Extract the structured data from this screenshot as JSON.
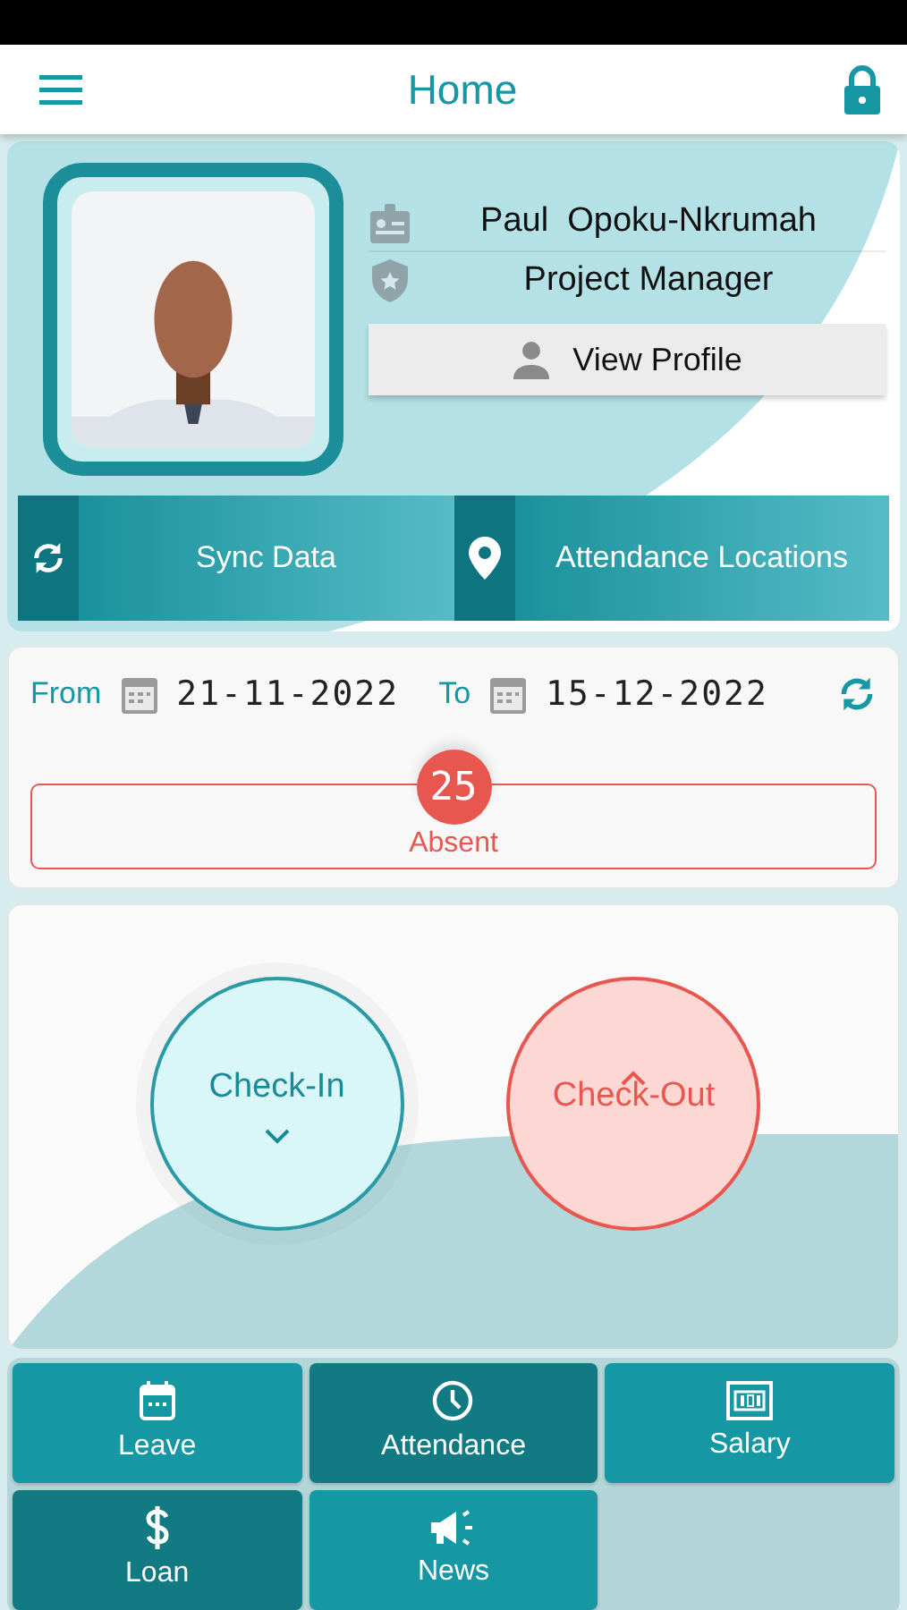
{
  "header": {
    "title": "Home"
  },
  "profile": {
    "name": "Paul  Opoku-Nkrumah",
    "position": "Project Manager",
    "view_button": "View Profile"
  },
  "actions": [
    {
      "kind": "sync",
      "label": "Sync Data"
    },
    {
      "kind": "location",
      "label": "Attendance Locations"
    }
  ],
  "date_range": {
    "from_label": "From",
    "from_value": "21-11-2022",
    "to_label": "To",
    "to_value": "15-12-2022"
  },
  "absent": {
    "count": "25",
    "label": "Absent"
  },
  "check_buttons": [
    {
      "kind": "in",
      "label": "Check-In"
    },
    {
      "kind": "out",
      "label": "Check-Out"
    }
  ],
  "tiles": [
    {
      "kind": "calendar",
      "label": "Leave",
      "color": "#1597a4"
    },
    {
      "kind": "clock",
      "label": "Attendance",
      "color": "#127a83"
    },
    {
      "kind": "salary",
      "label": "Salary",
      "color": "#1597a4"
    },
    {
      "kind": "dollar",
      "label": "Loan",
      "color": "#127a83"
    },
    {
      "kind": "megaphone",
      "label": "News",
      "color": "#1597a4"
    }
  ]
}
